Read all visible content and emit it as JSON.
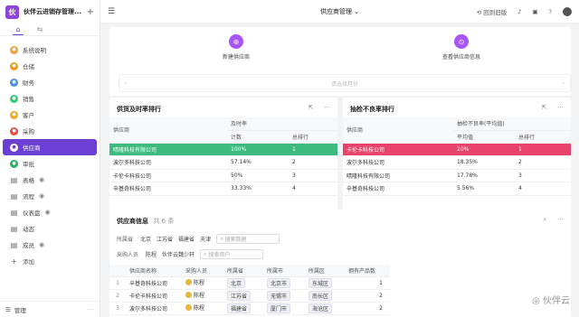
{
  "app": {
    "title": "伙伴云进销存管理...",
    "logo_text": "伙"
  },
  "sidebar": {
    "items": [
      {
        "label": "系统说明",
        "color": "#f0a23b"
      },
      {
        "label": "仓储",
        "color": "#f39c12"
      },
      {
        "label": "财务",
        "color": "#4a90e2"
      },
      {
        "label": "销售",
        "color": "#2ecc71"
      },
      {
        "label": "客户",
        "color": "#f5a623"
      },
      {
        "label": "采购",
        "color": "#e74c3c"
      },
      {
        "label": "供应商",
        "color": "#6b3fd4",
        "active": true
      },
      {
        "label": "审批",
        "color": "#27ae60"
      },
      {
        "label": "表格",
        "icon": "grid-icon",
        "eye": true
      },
      {
        "label": "流程",
        "icon": "flow-icon",
        "eye": true
      },
      {
        "label": "仪表盘",
        "icon": "dashboard-icon",
        "eye": true
      },
      {
        "label": "动态",
        "icon": "activity-icon"
      },
      {
        "label": "成员",
        "icon": "members-icon",
        "eye": true
      }
    ],
    "add_label": "添加",
    "footer_label": "管理"
  },
  "topbar": {
    "title": "供应商管理",
    "back_label": "回到旧版"
  },
  "actions": [
    {
      "label": "新建供应商"
    },
    {
      "label": "查看供应商信息"
    }
  ],
  "month_selector": {
    "placeholder": "请选择月份"
  },
  "panel_ontime": {
    "title": "供货及时率排行",
    "headers": {
      "supplier": "供应商",
      "group": "及时率",
      "count": "计数",
      "rank": "总排行"
    },
    "rows": [
      {
        "name": "晴隆科技有限公司",
        "value": "100%",
        "rank": "1"
      },
      {
        "name": "波尔多科技公司",
        "value": "57.14%",
        "rank": "2"
      },
      {
        "name": "卡伦卡科技公司",
        "value": "50%",
        "rank": "3"
      },
      {
        "name": "辛基奇科技公司",
        "value": "33.33%",
        "rank": "4"
      }
    ]
  },
  "panel_defect": {
    "title": "抽检不良率排行",
    "headers": {
      "supplier": "供应商",
      "group": "抽检不良率(平均值)",
      "count": "平均值",
      "rank": "总排行"
    },
    "rows": [
      {
        "name": "卡伦卡科技公司",
        "value": "20%",
        "rank": "1"
      },
      {
        "name": "波尔多科技公司",
        "value": "18.35%",
        "rank": "2"
      },
      {
        "name": "晴隆科技有限公司",
        "value": "17.78%",
        "rank": "3"
      },
      {
        "name": "辛基奇科技公司",
        "value": "5.56%",
        "rank": "4"
      }
    ]
  },
  "supplier_info": {
    "title": "供应商信息",
    "count": "共 6 条",
    "province_label": "所属省",
    "provinces": [
      "北京",
      "江苏省",
      "福建省",
      "天津"
    ],
    "search_data_placeholder": "搜索数据",
    "buyer_label": "采购人员",
    "buyers": [
      "陈程",
      "伙伴云魏少轩"
    ],
    "search_user_placeholder": "搜索用户",
    "headers": [
      "供应商名称",
      "采购人员",
      "所属省",
      "所属市",
      "所属区",
      "拥有产品数"
    ],
    "rows": [
      {
        "idx": "1",
        "name": "辛基奇科技公司",
        "buyer": "陈程",
        "province": "北京",
        "city": "北京市",
        "district": "东城区",
        "products": "1"
      },
      {
        "idx": "2",
        "name": "卡伦卡科技公司",
        "buyer": "陈程",
        "province": "江苏省",
        "city": "无锡市",
        "district": "南长区",
        "products": "2"
      },
      {
        "idx": "3",
        "name": "波尔多科技公司",
        "buyer": "陈程",
        "province": "福建省",
        "city": "厦门市",
        "district": "海沧区",
        "products": "2"
      }
    ]
  },
  "watermark": "伙伴云"
}
